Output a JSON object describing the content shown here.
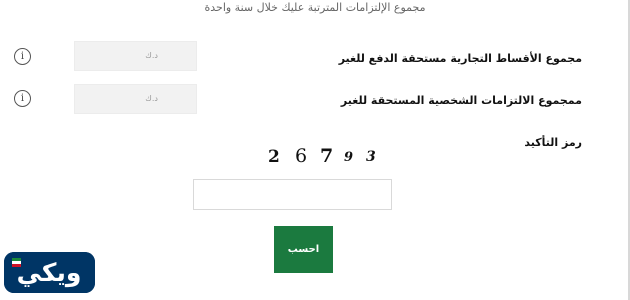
{
  "header": {
    "text": "مجموع الإلتزامات المترتبة عليك خلال سنة واحدة"
  },
  "form": {
    "commercial_installments": {
      "label": "مجموع الأقساط التجارية مستحقة الدفع للغير",
      "placeholder": "د.ك",
      "value": ""
    },
    "personal_obligations": {
      "label": "ممجموع الالتزامات الشخصية المستحقة للغير",
      "placeholder": "د.ك",
      "value": ""
    },
    "confirmation_code": {
      "label": "رمز التأكيد",
      "captcha_chars": [
        "2",
        "6",
        "7",
        "9",
        "3"
      ],
      "value": ""
    },
    "submit_label": "احسب"
  },
  "icons": {
    "info": "info-icon",
    "info_glyph": "i"
  },
  "logo": {
    "text": "ويكي",
    "colors": {
      "background": "#003565",
      "text": "#ffffff",
      "flag_green": "#1b8a3a",
      "flag_red": "#ce1126"
    }
  },
  "colors": {
    "accent": "#1b7a3f",
    "field_bg": "#f2f2f2"
  }
}
